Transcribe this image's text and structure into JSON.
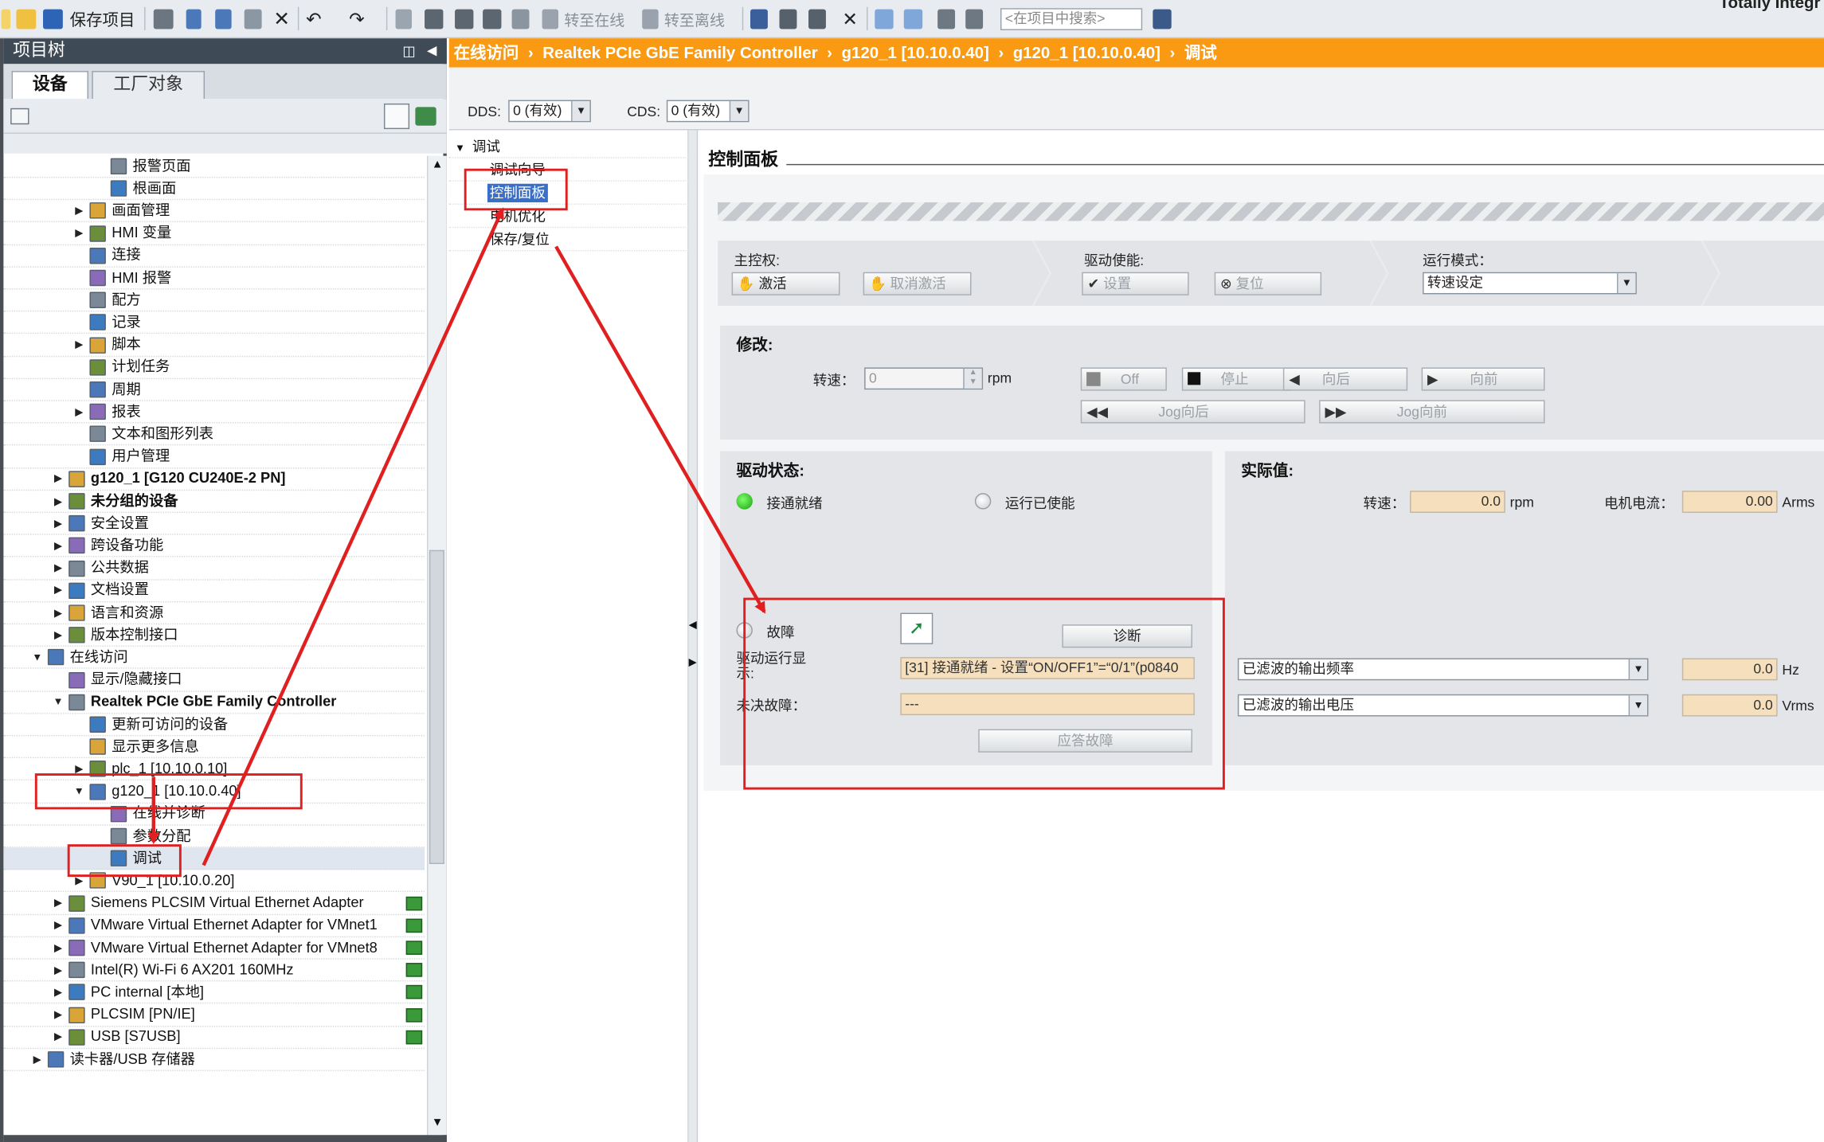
{
  "toolbar": {
    "save_project": "保存项目",
    "go_online": "转至在线",
    "go_offline": "转至离线",
    "search_placeholder": "<在项目中搜索>",
    "corner_text": "Totally Integr"
  },
  "project_tree": {
    "title": "项目树",
    "tabs": [
      "设备",
      "工厂对象"
    ],
    "items": [
      {
        "label": "报警页面",
        "indent": 4,
        "expander": ""
      },
      {
        "label": "根画面",
        "indent": 4,
        "expander": ""
      },
      {
        "label": "画面管理",
        "indent": 3,
        "expander": "▶"
      },
      {
        "label": "HMI 变量",
        "indent": 3,
        "expander": "▶"
      },
      {
        "label": "连接",
        "indent": 3,
        "expander": ""
      },
      {
        "label": "HMI 报警",
        "indent": 3,
        "expander": ""
      },
      {
        "label": "配方",
        "indent": 3,
        "expander": ""
      },
      {
        "label": "记录",
        "indent": 3,
        "expander": ""
      },
      {
        "label": "脚本",
        "indent": 3,
        "expander": "▶"
      },
      {
        "label": "计划任务",
        "indent": 3,
        "expander": ""
      },
      {
        "label": "周期",
        "indent": 3,
        "expander": ""
      },
      {
        "label": "报表",
        "indent": 3,
        "expander": "▶"
      },
      {
        "label": "文本和图形列表",
        "indent": 3,
        "expander": ""
      },
      {
        "label": "用户管理",
        "indent": 3,
        "expander": ""
      },
      {
        "label": "g120_1 [G120 CU240E-2 PN]",
        "indent": 2,
        "expander": "▶",
        "bold": true
      },
      {
        "label": "未分组的设备",
        "indent": 2,
        "expander": "▶",
        "bold": true
      },
      {
        "label": "安全设置",
        "indent": 2,
        "expander": "▶"
      },
      {
        "label": "跨设备功能",
        "indent": 2,
        "expander": "▶"
      },
      {
        "label": "公共数据",
        "indent": 2,
        "expander": "▶"
      },
      {
        "label": "文档设置",
        "indent": 2,
        "expander": "▶"
      },
      {
        "label": "语言和资源",
        "indent": 2,
        "expander": "▶"
      },
      {
        "label": "版本控制接口",
        "indent": 2,
        "expander": "▶"
      },
      {
        "label": "在线访问",
        "indent": 1,
        "expander": "▼"
      },
      {
        "label": "显示/隐藏接口",
        "indent": 2,
        "expander": ""
      },
      {
        "label": "Realtek PCIe GbE Family Controller",
        "indent": 2,
        "expander": "▼",
        "bold": true
      },
      {
        "label": "更新可访问的设备",
        "indent": 3,
        "expander": ""
      },
      {
        "label": "显示更多信息",
        "indent": 3,
        "expander": ""
      },
      {
        "label": "plc_1 [10.10.0.10]",
        "indent": 3,
        "expander": "▶"
      },
      {
        "label": "g120_1 [10.10.0.40]",
        "indent": 3,
        "expander": "▼"
      },
      {
        "label": "在线并诊断",
        "indent": 4,
        "expander": ""
      },
      {
        "label": "参数分配",
        "indent": 4,
        "expander": ""
      },
      {
        "label": "调试",
        "indent": 4,
        "expander": "",
        "selected": true
      },
      {
        "label": "V90_1 [10.10.0.20]",
        "indent": 3,
        "expander": "▶"
      },
      {
        "label": "Siemens PLCSIM Virtual Ethernet Adapter",
        "indent": 2,
        "expander": "▶",
        "status": true
      },
      {
        "label": "VMware Virtual Ethernet Adapter for VMnet1",
        "indent": 2,
        "expander": "▶",
        "status": true
      },
      {
        "label": "VMware Virtual Ethernet Adapter for VMnet8",
        "indent": 2,
        "expander": "▶",
        "status": true
      },
      {
        "label": "Intel(R) Wi-Fi 6 AX201 160MHz",
        "indent": 2,
        "expander": "▶",
        "status": true
      },
      {
        "label": "PC internal [本地]",
        "indent": 2,
        "expander": "▶",
        "status": true
      },
      {
        "label": "PLCSIM [PN/IE]",
        "indent": 2,
        "expander": "▶",
        "status": true
      },
      {
        "label": "USB [S7USB]",
        "indent": 2,
        "expander": "▶",
        "status": true
      },
      {
        "label": "读卡器/USB 存储器",
        "indent": 1,
        "expander": "▶"
      }
    ]
  },
  "breadcrumb": [
    "在线访问",
    "Realtek PCIe GbE Family Controller",
    "g120_1 [10.10.0.40]",
    "g120_1 [10.10.0.40]",
    "调试"
  ],
  "dds": {
    "label": "DDS:",
    "value": "0 (有效)"
  },
  "cds": {
    "label": "CDS:",
    "value": "0 (有效)"
  },
  "nav": {
    "header": "调试",
    "items": [
      "调试向导",
      "控制面板",
      "电机优化",
      "保存/复位"
    ]
  },
  "control_panel": {
    "title": "控制面板",
    "master": {
      "label": "主控权:",
      "activate": "激活",
      "deactivate": "取消激活"
    },
    "drive_enable": {
      "label": "驱动使能:",
      "set": "设置",
      "reset": "复位"
    },
    "mode": {
      "label": "运行模式：",
      "value": "转速设定"
    },
    "modify": {
      "label": "修改:",
      "speed_label": "转速：",
      "speed_value": "0",
      "unit": "rpm",
      "off": "Off",
      "stop": "停止",
      "backward": "向后",
      "forward": "向前",
      "jog_backward": "Jog向后",
      "jog_forward": "Jog向前"
    },
    "drive_status": {
      "label": "驱动状态:",
      "ready": "接通就绪",
      "run_enabled": "运行已使能",
      "fault": "故障",
      "diagnose": "诊断",
      "run_display_label": "驱动运行显示:",
      "run_display_value": "[31] 接通就绪 - 设置“ON/OFF1”=“0/1”(p0840",
      "pending_fault_label": "未决故障：",
      "pending_fault_value": "---",
      "ack_fault": "应答故障"
    },
    "actual": {
      "label": "实际值:",
      "speed_label": "转速：",
      "speed_value": "0.0",
      "speed_unit": "rpm",
      "current_label": "电机电流：",
      "current_value": "0.00",
      "current_unit": "Arms",
      "freq_select": "已滤波的输出频率",
      "freq_value": "0.0",
      "freq_unit": "Hz",
      "volt_select": "已滤波的输出电压",
      "volt_value": "0.0",
      "volt_unit": "Vrms"
    }
  },
  "colors": {
    "accent": "#fa9a12",
    "tree_title": "#3f4a57",
    "annotation": "#e02020",
    "field": "#f5dfbd"
  }
}
